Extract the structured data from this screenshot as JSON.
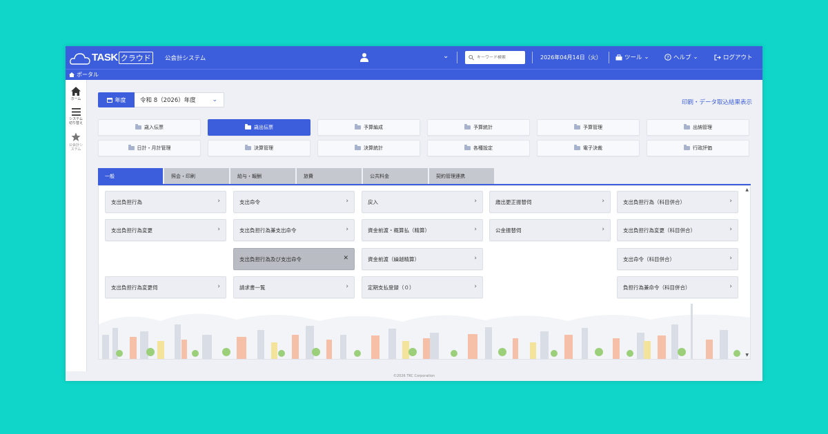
{
  "header": {
    "logo_task": "TASK",
    "logo_cloud": "クラウド",
    "system_name": "公会計システム",
    "search_placeholder": "キーワード検索",
    "date": "2026年04月14日（火）",
    "tools_label": "ツール",
    "help_label": "ヘルプ",
    "logout_label": "ログアウト"
  },
  "breadcrumb": {
    "label": "ポータル"
  },
  "sidebar": {
    "items": [
      {
        "label": "ホーム",
        "icon": "home-icon"
      },
      {
        "label": "システム切り替え",
        "icon": "menu-icon"
      },
      {
        "label": "公会計システム",
        "icon": "star-icon"
      }
    ]
  },
  "year": {
    "badge_label": "年度",
    "selected": "令和 8（2026）年度"
  },
  "print_link": "印刷・データ取込結果表示",
  "modules": [
    {
      "label": "歳入伝票",
      "active": false
    },
    {
      "label": "歳出伝票",
      "active": true
    },
    {
      "label": "予算編成",
      "active": false
    },
    {
      "label": "予算統計",
      "active": false
    },
    {
      "label": "予算管理",
      "active": false
    },
    {
      "label": "出納管理",
      "active": false
    },
    {
      "label": "日計・月計管理",
      "active": false
    },
    {
      "label": "決算管理",
      "active": false
    },
    {
      "label": "決算統計",
      "active": false
    },
    {
      "label": "各種設定",
      "active": false
    },
    {
      "label": "電子決裁",
      "active": false
    },
    {
      "label": "行政評価",
      "active": false
    }
  ],
  "tabs": [
    {
      "label": "一般",
      "active": true
    },
    {
      "label": "照会・印刷",
      "active": false
    },
    {
      "label": "給与・報酬",
      "active": false
    },
    {
      "label": "旅費",
      "active": false
    },
    {
      "label": "公共料金",
      "active": false
    },
    {
      "label": "契約管理連携",
      "active": false
    }
  ],
  "items": {
    "c0r0": "支出負担行為",
    "c0r1": "支出負担行為変更",
    "c0r3": "支出負担行為変更伺",
    "c1r0": "支出命令",
    "c1r1": "支出負担行為兼支出命令",
    "c1r2": "支出負担行為及び支出命令",
    "c1r3": "請求書一覧",
    "c2r0": "戻入",
    "c2r1": "資金前渡・概算払（精算）",
    "c2r2": "資金前渡（繰越精算）",
    "c2r3": "定期支払登録（０）",
    "c3r0": "歳出更正振替伺",
    "c3r1": "公金振替伺",
    "c4r0": "支出負担行為（科目併合）",
    "c4r1": "支出負担行為変更（科目併合）",
    "c4r2": "支出命令（科目併合）",
    "c4r3": "負担行為兼命令（科目併合）"
  },
  "footer": "©2026 TKC Corporation",
  "colors": {
    "accent": "#3d5edc",
    "background": "#0fd6c8"
  }
}
